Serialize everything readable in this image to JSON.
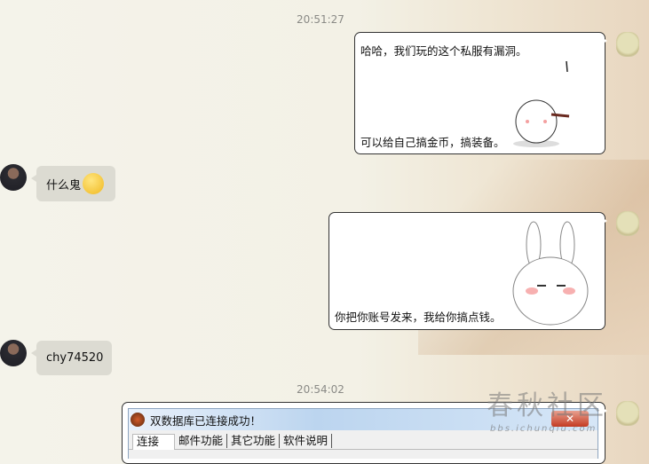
{
  "timestamps": [
    "20:51:27",
    "20:54:02"
  ],
  "messages": {
    "m1_line1": "哈哈，我们玩的这个私服有漏洞。",
    "m1_line2": "可以给自己搞金币，搞装备。",
    "m2": "什么鬼",
    "m3": "你把你账号发来，我给你搞点钱。",
    "m4": "chy74520"
  },
  "window": {
    "title": "双数据库已连接成功！",
    "close": "✕",
    "tabs": [
      "连接",
      "邮件功能",
      "其它功能",
      "软件说明"
    ]
  },
  "watermark": {
    "name": "春秋社区",
    "url": "bbs.ichunqiu.com"
  }
}
